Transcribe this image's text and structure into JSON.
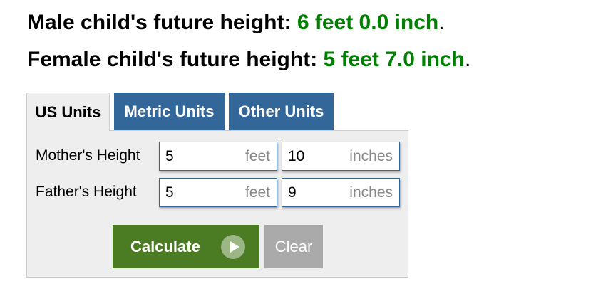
{
  "results": {
    "male_label": "Male child's future height:",
    "male_value": "6 feet 0.0 inch",
    "female_label": "Female child's future height:",
    "female_value": "5 feet 7.0 inch",
    "period": "."
  },
  "tabs": [
    {
      "label": "US Units",
      "active": true
    },
    {
      "label": "Metric Units",
      "active": false
    },
    {
      "label": "Other Units",
      "active": false
    }
  ],
  "form": {
    "mother": {
      "label": "Mother's Height",
      "feet_value": "5",
      "feet_unit": "feet",
      "inches_value": "10",
      "inches_unit": "inches"
    },
    "father": {
      "label": "Father's Height",
      "feet_value": "5",
      "feet_unit": "feet",
      "inches_value": "9",
      "inches_unit": "inches"
    }
  },
  "buttons": {
    "calculate_label": "Calculate",
    "clear_label": "Clear"
  },
  "colors": {
    "result_value": "#008000",
    "tab_inactive": "#336699",
    "calculate_bg": "#4b7b23",
    "clear_bg": "#aaaaaa",
    "panel_bg": "#eeeeee"
  },
  "icons": {
    "calculate": "play-circle-icon"
  }
}
